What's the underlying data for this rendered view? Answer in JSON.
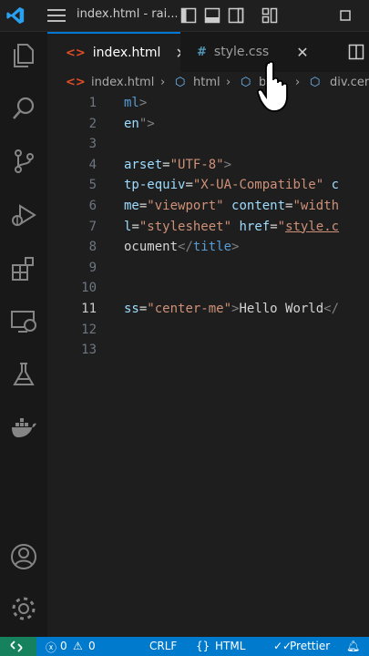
{
  "window": {
    "title": "index.html - rai..."
  },
  "activity_bar": {
    "items": [
      "explorer-icon",
      "search-icon",
      "source-control-icon",
      "run-debug-icon",
      "extensions-icon",
      "remote-explorer-icon",
      "testing-icon",
      "docker-icon"
    ],
    "bottom_items": [
      "accounts-icon",
      "settings-gear-icon"
    ]
  },
  "tabs": [
    {
      "label": "index.html",
      "icon": "<>",
      "icon_color": "#e44d26",
      "active": true,
      "close": "✕"
    },
    {
      "label": "style.css",
      "icon": "#",
      "icon_color": "#519aba",
      "active": false,
      "close": "✕"
    }
  ],
  "breadcrumb": {
    "items": [
      "index.html",
      "html",
      "bo",
      "div.cer"
    ]
  },
  "editor": {
    "active_line": 11,
    "lines": [
      {
        "num": "1",
        "tokens": [
          [
            "tag",
            "ml"
          ],
          [
            "punc",
            ">"
          ]
        ]
      },
      {
        "num": "2",
        "tokens": [
          [
            "attr",
            "en"
          ],
          [
            "punc",
            "\">"
          ]
        ]
      },
      {
        "num": "3",
        "tokens": []
      },
      {
        "num": "4",
        "tokens": [
          [
            "attr",
            "arset"
          ],
          [
            "txt",
            "="
          ],
          [
            "str",
            "\"UTF-8\""
          ],
          [
            "punc",
            ">"
          ]
        ]
      },
      {
        "num": "5",
        "tokens": [
          [
            "attr",
            "tp-equiv"
          ],
          [
            "txt",
            "="
          ],
          [
            "str",
            "\"X-UA-Compatible\""
          ],
          [
            "txt",
            " "
          ],
          [
            "attr",
            "c"
          ]
        ]
      },
      {
        "num": "6",
        "tokens": [
          [
            "attr",
            "me"
          ],
          [
            "txt",
            "="
          ],
          [
            "str",
            "\"viewport\""
          ],
          [
            "txt",
            " "
          ],
          [
            "attr",
            "content"
          ],
          [
            "txt",
            "="
          ],
          [
            "str",
            "\"width"
          ]
        ]
      },
      {
        "num": "7",
        "tokens": [
          [
            "attr",
            "l"
          ],
          [
            "txt",
            "="
          ],
          [
            "str",
            "\"stylesheet\""
          ],
          [
            "txt",
            " "
          ],
          [
            "attr",
            "href"
          ],
          [
            "txt",
            "="
          ],
          [
            "str",
            "\""
          ],
          [
            "strU",
            "style.c"
          ]
        ]
      },
      {
        "num": "8",
        "tokens": [
          [
            "txt",
            "ocument"
          ],
          [
            "punc",
            "</"
          ],
          [
            "tag",
            "title"
          ],
          [
            "punc",
            ">"
          ]
        ]
      },
      {
        "num": "9",
        "tokens": []
      },
      {
        "num": "10",
        "tokens": []
      },
      {
        "num": "11",
        "tokens": [
          [
            "attr",
            "ss"
          ],
          [
            "txt",
            "="
          ],
          [
            "str",
            "\"center-me\""
          ],
          [
            "punc",
            ">"
          ],
          [
            "txt",
            "Hello World"
          ],
          [
            "punc",
            "</"
          ]
        ]
      },
      {
        "num": "12",
        "tokens": []
      },
      {
        "num": "13",
        "tokens": []
      }
    ]
  },
  "status_bar": {
    "errors": "0",
    "warnings": "0",
    "line_ending": "CRLF",
    "language": "HTML",
    "formatter": "Prettier",
    "colors": {
      "bar": "#007acc",
      "remote": "#16825d"
    }
  }
}
